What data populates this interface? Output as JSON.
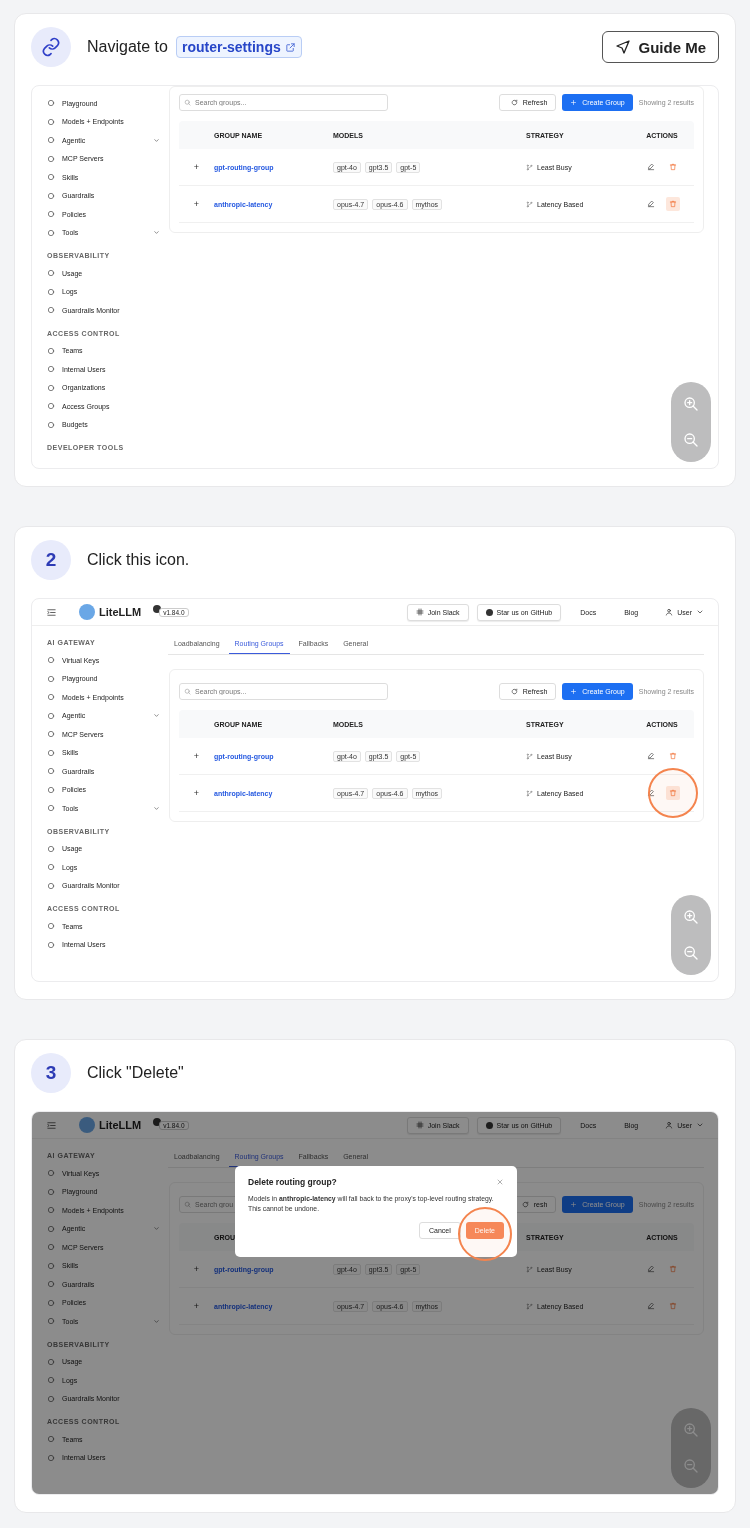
{
  "steps": [
    {
      "kind": "navigate",
      "label": "Navigate to",
      "link": "router-settings",
      "guide_button": "Guide Me",
      "screen": {
        "dimmed": false,
        "sidebar": [
          {
            "items": [
              {
                "label": "Playground",
                "has_submenu": false
              },
              {
                "label": "Models + Endpoints",
                "has_submenu": false
              },
              {
                "label": "Agentic",
                "has_submenu": true
              },
              {
                "label": "MCP Servers",
                "has_submenu": false
              },
              {
                "label": "Skills",
                "has_submenu": false
              },
              {
                "label": "Guardrails",
                "has_submenu": false
              },
              {
                "label": "Policies",
                "has_submenu": false
              },
              {
                "label": "Tools",
                "has_submenu": true
              }
            ]
          },
          {
            "heading": "OBSERVABILITY",
            "items": [
              {
                "label": "Usage",
                "has_submenu": false
              },
              {
                "label": "Logs",
                "has_submenu": false
              },
              {
                "label": "Guardrails Monitor",
                "has_submenu": false
              }
            ]
          },
          {
            "heading": "ACCESS CONTROL",
            "items": [
              {
                "label": "Teams",
                "has_submenu": false
              },
              {
                "label": "Internal Users",
                "has_submenu": false
              },
              {
                "label": "Organizations",
                "has_submenu": false
              },
              {
                "label": "Access Groups",
                "has_submenu": false
              },
              {
                "label": "Budgets",
                "has_submenu": false
              }
            ]
          },
          {
            "heading": "DEVELOPER TOOLS"
          }
        ],
        "toolbar": {
          "search_placeholder": "Search groups...",
          "refresh": "Refresh",
          "create": "Create Group",
          "results": "Showing 2 results"
        },
        "table": {
          "columns": [
            {
              "label": "GROUP NAME"
            },
            {
              "label": "MODELS"
            },
            {
              "label": "STRATEGY"
            },
            {
              "label": "ACTIONS"
            }
          ],
          "rows": [
            {
              "expand": "+",
              "name": "gpt-routing-group",
              "models": [
                "gpt-4o",
                "gpt3.5",
                "gpt-5"
              ],
              "strategy": "Least Busy",
              "delete_hovered": false,
              "highlighted": false
            },
            {
              "expand": "+",
              "name": "anthropic-latency",
              "models": [
                "opus-4.7",
                "opus-4.6",
                "mythos"
              ],
              "strategy": "Latency Based",
              "delete_hovered": true,
              "highlighted": false
            }
          ]
        }
      }
    },
    {
      "kind": "instruction",
      "number": "2",
      "label": "Click this icon.",
      "screen": {
        "dimmed": false,
        "header": {
          "brand": "LiteLLM",
          "version": "v1.84.0",
          "buttons": [
            "Join Slack",
            "Star us on GitHub"
          ],
          "links": [
            "Docs",
            "Blog"
          ],
          "user": "User"
        },
        "tabs": [
          {
            "label": "Loadbalancing",
            "selected": false
          },
          {
            "label": "Routing Groups",
            "selected": true
          },
          {
            "label": "Fallbacks",
            "selected": false
          },
          {
            "label": "General",
            "selected": false
          }
        ],
        "sidebar": [
          {
            "heading": "AI GATEWAY",
            "items": [
              {
                "label": "Virtual Keys",
                "has_submenu": false
              },
              {
                "label": "Playground",
                "has_submenu": false
              },
              {
                "label": "Models + Endpoints",
                "has_submenu": false
              },
              {
                "label": "Agentic",
                "has_submenu": true
              },
              {
                "label": "MCP Servers",
                "has_submenu": false
              },
              {
                "label": "Skills",
                "has_submenu": false
              },
              {
                "label": "Guardrails",
                "has_submenu": false
              },
              {
                "label": "Policies",
                "has_submenu": false
              },
              {
                "label": "Tools",
                "has_submenu": true
              }
            ]
          },
          {
            "heading": "OBSERVABILITY",
            "items": [
              {
                "label": "Usage",
                "has_submenu": false
              },
              {
                "label": "Logs",
                "has_submenu": false
              },
              {
                "label": "Guardrails Monitor",
                "has_submenu": false
              }
            ]
          },
          {
            "heading": "ACCESS CONTROL",
            "items": [
              {
                "label": "Teams",
                "has_submenu": false
              },
              {
                "label": "Internal Users",
                "has_submenu": false
              }
            ]
          }
        ],
        "toolbar": {
          "search_placeholder": "Search groups...",
          "refresh": "Refresh",
          "create": "Create Group",
          "results": "Showing 2 results"
        },
        "table": {
          "columns": [
            {
              "label": "GROUP NAME"
            },
            {
              "label": "MODELS"
            },
            {
              "label": "STRATEGY"
            },
            {
              "label": "ACTIONS"
            }
          ],
          "rows": [
            {
              "expand": "+",
              "name": "gpt-routing-group",
              "models": [
                "gpt-4o",
                "gpt3.5",
                "gpt-5"
              ],
              "strategy": "Least Busy",
              "delete_hovered": false,
              "highlighted": false
            },
            {
              "expand": "+",
              "name": "anthropic-latency",
              "models": [
                "opus-4.7",
                "opus-4.6",
                "mythos"
              ],
              "strategy": "Latency Based",
              "delete_hovered": true,
              "highlighted": true
            }
          ]
        }
      }
    },
    {
      "kind": "instruction",
      "number": "3",
      "label": "Click \"Delete\"",
      "screen": {
        "dimmed": true,
        "header": {
          "brand": "LiteLLM",
          "version": "v1.84.0",
          "buttons": [
            "Join Slack",
            "Star us on GitHub"
          ],
          "links": [
            "Docs",
            "Blog"
          ],
          "user": "User"
        },
        "tabs": [
          {
            "label": "Loadbalancing",
            "selected": false
          },
          {
            "label": "Routing Groups",
            "selected": true
          },
          {
            "label": "Fallbacks",
            "selected": false
          },
          {
            "label": "General",
            "selected": false
          }
        ],
        "sidebar": [
          {
            "heading": "AI GATEWAY",
            "items": [
              {
                "label": "Virtual Keys",
                "has_submenu": false
              },
              {
                "label": "Playground",
                "has_submenu": false
              },
              {
                "label": "Models + Endpoints",
                "has_submenu": false
              },
              {
                "label": "Agentic",
                "has_submenu": true
              },
              {
                "label": "MCP Servers",
                "has_submenu": false
              },
              {
                "label": "Skills",
                "has_submenu": false
              },
              {
                "label": "Guardrails",
                "has_submenu": false
              },
              {
                "label": "Policies",
                "has_submenu": false
              },
              {
                "label": "Tools",
                "has_submenu": true
              }
            ]
          },
          {
            "heading": "OBSERVABILITY",
            "items": [
              {
                "label": "Usage",
                "has_submenu": false
              },
              {
                "label": "Logs",
                "has_submenu": false
              },
              {
                "label": "Guardrails Monitor",
                "has_submenu": false
              }
            ]
          },
          {
            "heading": "ACCESS CONTROL",
            "items": [
              {
                "label": "Teams",
                "has_submenu": false
              },
              {
                "label": "Internal Users",
                "has_submenu": false
              }
            ]
          }
        ],
        "toolbar": {
          "search_placeholder": "Search grou",
          "refresh": "resh",
          "create": "Create Group",
          "results": "Showing 2 results"
        },
        "table": {
          "columns": [
            {
              "label": "GROU"
            },
            {},
            {
              "label": "STRATEGY"
            },
            {
              "label": "ACTIONS"
            }
          ],
          "rows": [
            {
              "expand": "+",
              "name": "gpt-routing-group",
              "models": [
                "gpt-4o",
                "gpt3.5",
                "gpt-5"
              ],
              "strategy": "Least Busy",
              "delete_hovered": false,
              "highlighted": false
            },
            {
              "expand": "+",
              "name": "anthropic-latency",
              "models": [
                "opus-4.7",
                "opus-4.6",
                "mythos"
              ],
              "strategy": "Latency Based",
              "delete_hovered": false,
              "highlighted": false
            }
          ]
        },
        "dialog": {
          "title": "Delete routing group?",
          "message": "Models in **anthropic-latency** will fall back to the proxy's top-level routing strategy. This cannot be undone.",
          "buttons": [
            {
              "label": "Cancel",
              "kind": "secondary",
              "highlighted": false
            },
            {
              "label": "Delete",
              "kind": "danger",
              "highlighted": true
            }
          ]
        }
      }
    }
  ]
}
